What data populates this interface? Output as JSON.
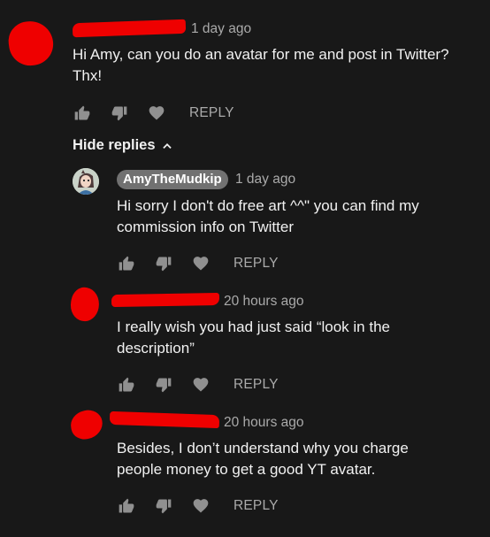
{
  "comments": [
    {
      "time": "1 day ago",
      "text_line1": "Hi Amy, can you do an avatar for me and post in Twitter?",
      "text_line2": "Thx!",
      "reply_label": "REPLY"
    }
  ],
  "hide_replies_label": "Hide replies",
  "replies": [
    {
      "author": "AmyTheMudkip",
      "time": "1 day ago",
      "text_line1": "Hi sorry I don't do free art ^^\" you can find my",
      "text_line2": "commission info on Twitter",
      "reply_label": "REPLY"
    },
    {
      "time": "20 hours ago",
      "text_line1": "I really wish you had just said “look in the",
      "text_line2": "description”",
      "reply_label": "REPLY"
    },
    {
      "time": "20 hours ago",
      "text_line1": "Besides, I don’t understand why you charge",
      "text_line2": "people money to get a good YT avatar.",
      "reply_label": "REPLY"
    }
  ],
  "colors": {
    "background": "#181818",
    "text": "#f1f1f1",
    "meta": "#aaaaaa",
    "redaction": "#ef0000",
    "author_badge": "#717171"
  },
  "icons": [
    "like-icon",
    "dislike-icon",
    "heart-icon",
    "chevron-up-icon"
  ]
}
